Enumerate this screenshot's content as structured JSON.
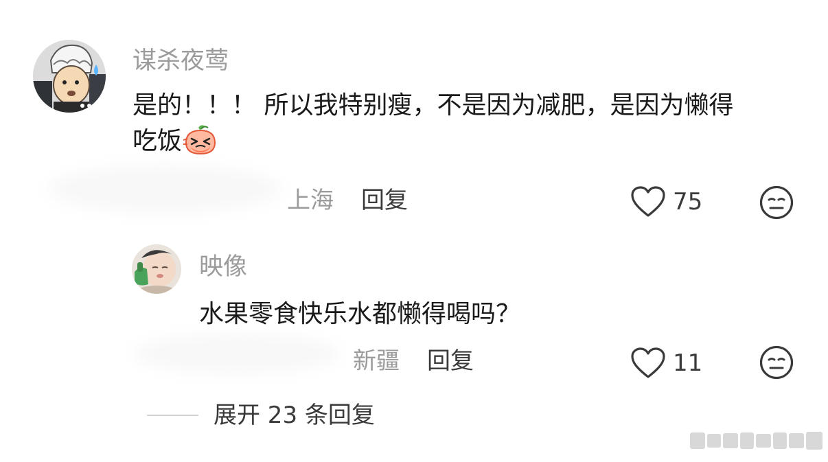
{
  "comment": {
    "username": "谋杀夜莺",
    "text_line1": "是的！！！ 所以我特别瘦，不是因为减肥，是因为懒得",
    "text_line2": "吃饭",
    "emoji": "crying-peach-emoji",
    "location": "上海",
    "reply_label": "回复",
    "like_count": "75",
    "avatar": "cartoon-character-avatar"
  },
  "reply": {
    "username": "映像",
    "text": "水果零食快乐水都懒得喝吗？",
    "location": "新疆",
    "reply_label": "回复",
    "like_count": "11",
    "avatar": "baby-photo-avatar"
  },
  "expand": {
    "label": "展开 23 条回复"
  },
  "icons": {
    "like": "heart-outline-icon",
    "reaction": "meh-face-icon"
  },
  "colors": {
    "username": "#9b9b9b",
    "text": "#1a1a1a",
    "secondary": "#3a3a3a"
  }
}
